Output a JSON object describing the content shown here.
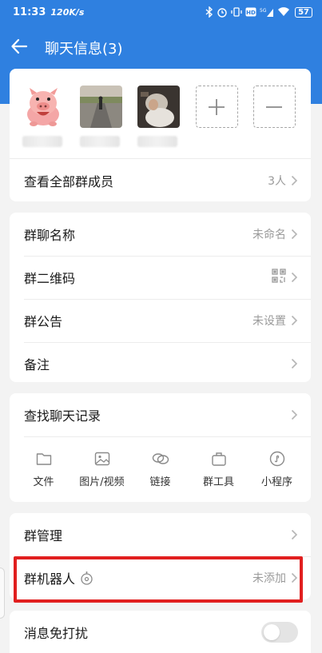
{
  "status_bar": {
    "time": "11:33",
    "speed": "120K/s",
    "battery": "57",
    "icons": [
      "bluetooth-icon",
      "alarm-icon",
      "vibrate-icon",
      "hd-icon",
      "signal-5g-icon",
      "wifi-icon"
    ]
  },
  "header": {
    "title": "聊天信息(3)"
  },
  "members": {
    "avatars": [
      {
        "icon": "pig-cartoon-avatar"
      },
      {
        "icon": "road-photo-avatar"
      },
      {
        "icon": "person-photo-avatar"
      }
    ],
    "view_all_label": "查看全部群成员",
    "count": "3人"
  },
  "group_settings": {
    "name_label": "群聊名称",
    "name_value": "未命名",
    "qr_label": "群二维码",
    "notice_label": "群公告",
    "notice_value": "未设置",
    "remark_label": "备注"
  },
  "history": {
    "search_label": "查找聊天记录",
    "tools": [
      {
        "label": "文件",
        "icon": "folder-icon"
      },
      {
        "label": "图片/视频",
        "icon": "image-icon"
      },
      {
        "label": "链接",
        "icon": "link-icon"
      },
      {
        "label": "群工具",
        "icon": "toolbox-icon"
      },
      {
        "label": "小程序",
        "icon": "mini-program-icon"
      }
    ]
  },
  "management": {
    "manage_label": "群管理",
    "robot_label": "群机器人",
    "robot_value": "未添加"
  },
  "notifications": {
    "mute_label": "消息免打扰",
    "mute_on": false
  },
  "colors": {
    "header_blue": "#2f80e0",
    "highlight_red": "#e11f1f"
  }
}
